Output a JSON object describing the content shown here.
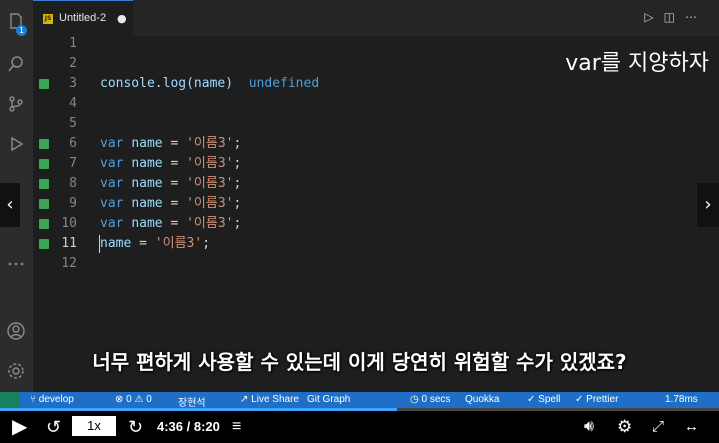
{
  "tab": {
    "label": "Untitled-2",
    "dirty": "●",
    "lang": "JS"
  },
  "activity": {
    "badge": "1"
  },
  "code": {
    "lines": [
      {
        "n": "1"
      },
      {
        "n": "2"
      },
      {
        "n": "3",
        "text": "console.log(name)",
        "hint": "undefined"
      },
      {
        "n": "4"
      },
      {
        "n": "5"
      },
      {
        "n": "6",
        "kw": "var",
        "name": "name",
        "eq": " = ",
        "str": "'이름3'",
        "end": ";"
      },
      {
        "n": "7",
        "kw": "var",
        "name": "name",
        "eq": " = ",
        "str": "'이름3'",
        "end": ";"
      },
      {
        "n": "8",
        "kw": "var",
        "name": "name",
        "eq": " = ",
        "str": "'이름3'",
        "end": ";"
      },
      {
        "n": "9",
        "kw": "var",
        "name": "name",
        "eq": " = ",
        "str": "'이름3'",
        "end": ";"
      },
      {
        "n": "10",
        "kw": "var",
        "name": "name",
        "eq": " = ",
        "str": "'이름3'",
        "end": ";"
      },
      {
        "n": "11",
        "name": "name",
        "eq": " = ",
        "str": "'이름3'",
        "end": ";"
      },
      {
        "n": "12"
      }
    ]
  },
  "overlay": {
    "title": "var를 지양하자",
    "subtitle": "너무 편하게 사용할 수 있는데 이게 당연히 위험할 수가 있겠죠?"
  },
  "statusbar": {
    "branch": "develop",
    "problems": "⊗ 0 ⚠ 0",
    "author": "장현석",
    "live_share": "Live Share",
    "git_graph": "Git Graph",
    "timer": "0 secs",
    "quokka": "Quokka",
    "spell": "Spell",
    "prettier": "Prettier",
    "perf": "1.78ms"
  },
  "player": {
    "time": "4:36 / 8:20",
    "speed": "1x",
    "progress": 0.552
  }
}
